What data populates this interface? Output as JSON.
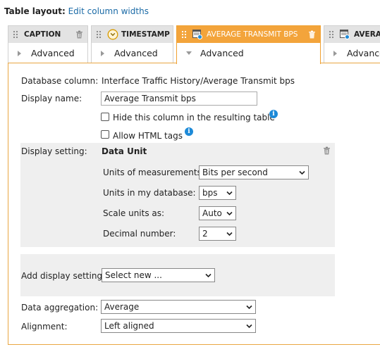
{
  "header": {
    "label": "Table layout:",
    "link": "Edit column widths"
  },
  "columns": [
    {
      "name": "CAPTION",
      "advanced": "Advanced"
    },
    {
      "name": "TIMESTAMP",
      "advanced": "Advanced"
    },
    {
      "name": "AVERAGE TRANSMIT BPS",
      "advanced": "Advanced"
    },
    {
      "name": "AVERA",
      "advanced": "Advance"
    }
  ],
  "form": {
    "db_column_label": "Database column:",
    "db_column_value": "Interface Traffic History/Average Transmit bps",
    "display_name_label": "Display name:",
    "display_name_value": "Average Transmit bps",
    "hide_column_label": "Hide this column in the resulting table",
    "allow_html_label": "Allow HTML tags",
    "display_setting_label": "Display setting:",
    "data_unit_title": "Data Unit",
    "units_measure_label": "Units of measurements:",
    "units_measure_value": "Bits per second",
    "units_db_label": "Units in my database:",
    "units_db_value": "bps",
    "scale_label": "Scale units as:",
    "scale_value": "Auto",
    "decimal_label": "Decimal number:",
    "decimal_value": "2",
    "add_display_label": "Add display settings:",
    "add_display_value": "Select new ...",
    "aggregation_label": "Data aggregation:",
    "aggregation_value": "Average",
    "alignment_label": "Alignment:",
    "alignment_value": "Left aligned"
  },
  "colors": {
    "accent": "#f3a43b",
    "link": "#1a6aa6",
    "info": "#1d8ad8"
  }
}
